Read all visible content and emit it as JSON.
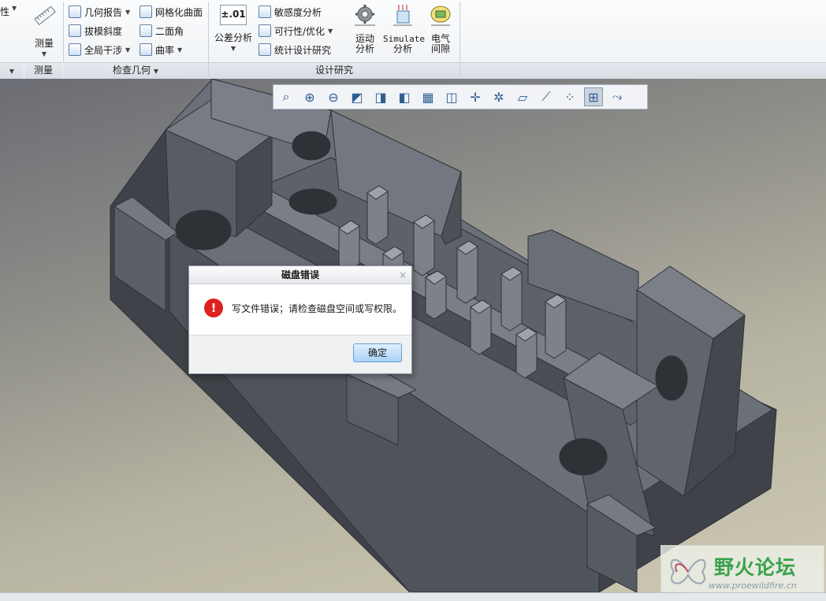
{
  "ribbon": {
    "partial_left_label": "性",
    "measure_label": "测量",
    "inspect_geometry": {
      "col1": [
        "几何报告",
        "拔模斜度",
        "全局干涉"
      ],
      "col2": [
        "网格化曲面",
        "二面角",
        "曲率"
      ]
    },
    "tolerance": {
      "icon_text": "±.01",
      "label": "公差分析"
    },
    "design_study": [
      "敏感度分析",
      "可行性/优化",
      "统计设计研究"
    ],
    "motion_label": [
      "运动",
      "分析"
    ],
    "simulate_label": [
      "Simulate",
      "分析"
    ],
    "electrical_label": [
      "电气",
      "间隙"
    ],
    "groups": {
      "measure": "测量",
      "inspect_geometry": "检查几何",
      "design_study": "设计研究"
    }
  },
  "graphics_toolbar": {
    "icons": [
      "refit-icon",
      "zoom-in-icon",
      "zoom-out-icon",
      "repaint-icon",
      "display-style-icon",
      "saved-orientations-icon",
      "view-manager-icon",
      "perspective-icon",
      "spin-center-icon",
      "datum-display-icon",
      "plane-display-icon",
      "axis-display-icon",
      "point-display-icon",
      "csys-display-icon",
      "annotation-display-icon"
    ],
    "active_index": 13
  },
  "dialog": {
    "title": "磁盘错误",
    "close": "×",
    "message": "写文件错误；请检查磁盘空间或写权限。",
    "ok_label": "确定"
  },
  "watermark": {
    "title": "野火论坛",
    "url": "www.proewildfire.cn"
  }
}
